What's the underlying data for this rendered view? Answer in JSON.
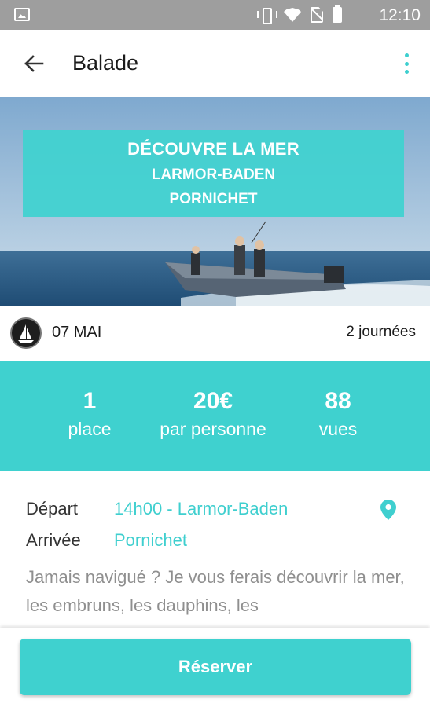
{
  "status_bar": {
    "time": "12:10",
    "icons": [
      "image-icon",
      "vibrate-icon",
      "wifi-icon",
      "no-sim-icon",
      "battery-icon"
    ]
  },
  "app_bar": {
    "title": "Balade",
    "back_icon": "arrow-back-icon",
    "menu_icon": "more-vert-icon"
  },
  "hero": {
    "title": "DÉCOUVRE LA MER",
    "from": "LARMOR-BADEN",
    "to": "PORNICHET"
  },
  "date_row": {
    "date": "07 MAI",
    "duration": "2 journées",
    "badge_icon": "sailboat-icon"
  },
  "stats": [
    {
      "value": "1",
      "label": "place"
    },
    {
      "value": "20€",
      "label": "par personne"
    },
    {
      "value": "88",
      "label": "vues"
    }
  ],
  "details": {
    "departure_label": "Départ",
    "departure_value": "14h00 - Larmor-Baden",
    "arrival_label": "Arrivée",
    "arrival_value": "Pornichet",
    "pin_icon": "location-pin-icon",
    "description": "Jamais navigué ? Je vous ferais découvrir la mer, les embruns, les dauphins, les"
  },
  "action": {
    "reserve_label": "Réserver"
  },
  "colors": {
    "accent": "#3fd1cf",
    "status_bar": "#9e9e9e",
    "text_dark": "#1b1b1b",
    "text_muted": "#8f8f8f"
  }
}
